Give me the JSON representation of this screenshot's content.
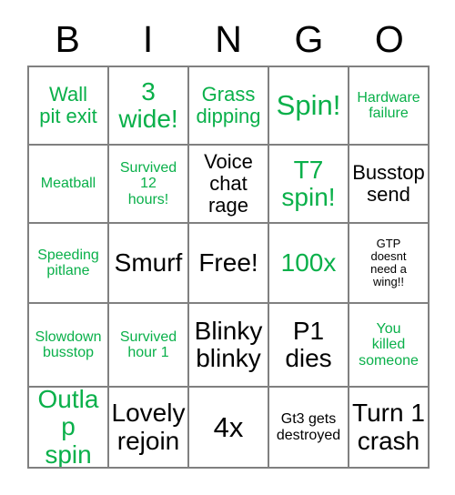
{
  "card": {
    "title": "BINGO",
    "headers": [
      "B",
      "I",
      "N",
      "G",
      "O"
    ],
    "marked_color": "#0ab04a",
    "unmarked_color": "#000000",
    "border_color": "#808080",
    "background_color": "#ffffff",
    "rows": 5,
    "columns": 5,
    "cells": [
      {
        "text": "Wall\npit exit",
        "marked": true,
        "size": "md"
      },
      {
        "text": "3\nwide!",
        "marked": true,
        "size": "lg"
      },
      {
        "text": "Grass\ndipping",
        "marked": true,
        "size": "md"
      },
      {
        "text": "Spin!",
        "marked": true,
        "size": "xl"
      },
      {
        "text": "Hardware\nfailure",
        "marked": true,
        "size": "sm"
      },
      {
        "text": "Meatball",
        "marked": true,
        "size": "sm"
      },
      {
        "text": "Survived\n12\nhours!",
        "marked": true,
        "size": "sm"
      },
      {
        "text": "Voice\nchat\nrage",
        "marked": false,
        "size": "md"
      },
      {
        "text": "T7\nspin!",
        "marked": true,
        "size": "lg"
      },
      {
        "text": "Busstop\nsend",
        "marked": false,
        "size": "md"
      },
      {
        "text": "Speeding\npitlane",
        "marked": true,
        "size": "sm"
      },
      {
        "text": "Smurf",
        "marked": false,
        "size": "lg"
      },
      {
        "text": "Free!",
        "marked": false,
        "size": "lg"
      },
      {
        "text": "100x",
        "marked": true,
        "size": "lg"
      },
      {
        "text": "GTP\ndoesnt\nneed a\nwing!!",
        "marked": false,
        "size": "xs"
      },
      {
        "text": "Slowdown\nbusstop",
        "marked": true,
        "size": "sm"
      },
      {
        "text": "Survived\nhour 1",
        "marked": true,
        "size": "sm"
      },
      {
        "text": "Blinky\nblinky",
        "marked": false,
        "size": "lg"
      },
      {
        "text": "P1\ndies",
        "marked": false,
        "size": "lg"
      },
      {
        "text": "You\nkilled\nsomeone",
        "marked": true,
        "size": "sm"
      },
      {
        "text": "Outlap\nspin",
        "marked": true,
        "size": "lg"
      },
      {
        "text": "Lovely\nrejoin",
        "marked": false,
        "size": "lg"
      },
      {
        "text": "4x",
        "marked": false,
        "size": "xl"
      },
      {
        "text": "Gt3 gets\ndestroyed",
        "marked": false,
        "size": "sm"
      },
      {
        "text": "Turn 1\ncrash",
        "marked": false,
        "size": "lg"
      }
    ]
  }
}
